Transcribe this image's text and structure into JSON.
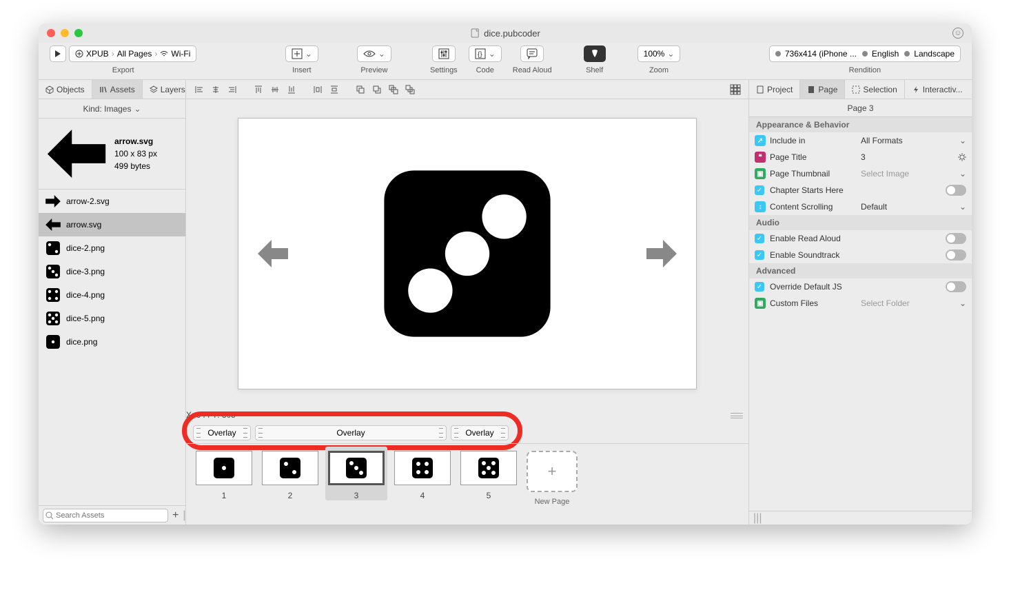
{
  "window": {
    "title": "dice.pubcoder"
  },
  "toolbar": {
    "export": {
      "label": "Export",
      "play": "▶",
      "format": "XPUB",
      "pages": "All Pages",
      "wifi": "Wi-Fi"
    },
    "insert": "Insert",
    "preview": "Preview",
    "settings": "Settings",
    "code": "Code",
    "read_aloud": "Read Aloud",
    "shelf": "Shelf",
    "zoom": {
      "label": "Zoom",
      "value": "100%"
    },
    "rendition": {
      "label": "Rendition",
      "device": "736x414 (iPhone ...",
      "lang": "English",
      "orientation": "Landscape"
    }
  },
  "left": {
    "tabs": {
      "objects": "Objects",
      "assets": "Assets",
      "layers": "Layers"
    },
    "kind": "Kind: Images",
    "preview": {
      "name": "arrow.svg",
      "dims": "100 x 83 px",
      "size": "499 bytes"
    },
    "items": [
      {
        "name": "arrow-2.svg",
        "type": "arrow-right"
      },
      {
        "name": "arrow.svg",
        "type": "arrow-left",
        "selected": true
      },
      {
        "name": "dice-2.png",
        "type": "dice2"
      },
      {
        "name": "dice-3.png",
        "type": "dice3"
      },
      {
        "name": "dice-4.png",
        "type": "dice4"
      },
      {
        "name": "dice-5.png",
        "type": "dice5"
      },
      {
        "name": "dice.png",
        "type": "dice1"
      }
    ],
    "search_placeholder": "Search Assets"
  },
  "canvas": {
    "coords": "X: 644    Y: 305",
    "overlays": [
      "Overlay",
      "Overlay",
      "Overlay"
    ]
  },
  "pages": {
    "items": [
      {
        "num": "1",
        "dice": 1
      },
      {
        "num": "2",
        "dice": 2
      },
      {
        "num": "3",
        "dice": 3,
        "selected": true
      },
      {
        "num": "4",
        "dice": 4
      },
      {
        "num": "5",
        "dice": 5
      }
    ],
    "new_label": "New Page"
  },
  "right": {
    "tabs": {
      "project": "Project",
      "page": "Page",
      "selection": "Selection",
      "interactivity": "Interactiv..."
    },
    "header": "Page 3",
    "sections": {
      "appearance": "Appearance & Behavior",
      "audio": "Audio",
      "advanced": "Advanced"
    },
    "props": {
      "include_in": {
        "label": "Include in",
        "value": "All Formats"
      },
      "page_title": {
        "label": "Page Title",
        "value": "3"
      },
      "page_thumbnail": {
        "label": "Page Thumbnail",
        "value": "Select Image"
      },
      "chapter_starts": {
        "label": "Chapter Starts Here"
      },
      "content_scrolling": {
        "label": "Content Scrolling",
        "value": "Default"
      },
      "enable_read_aloud": {
        "label": "Enable Read Aloud"
      },
      "enable_soundtrack": {
        "label": "Enable Soundtrack"
      },
      "override_js": {
        "label": "Override Default JS"
      },
      "custom_files": {
        "label": "Custom Files",
        "value": "Select Folder"
      }
    }
  }
}
